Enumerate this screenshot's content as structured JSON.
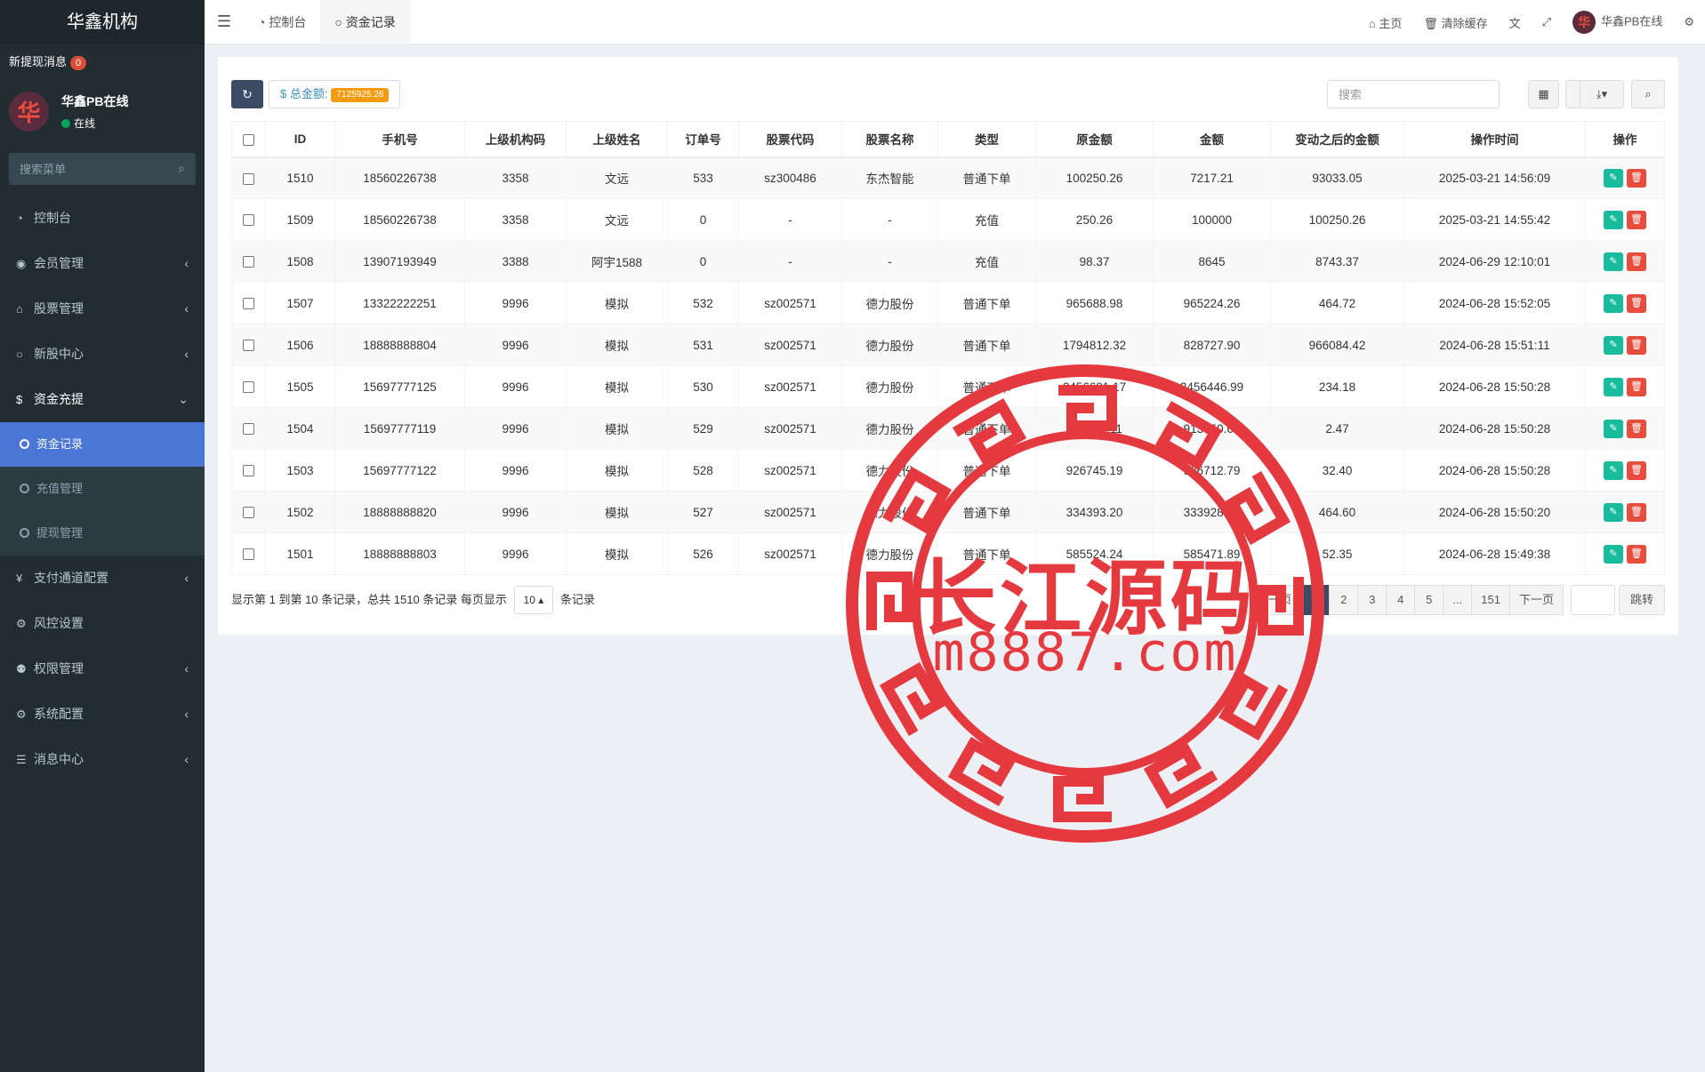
{
  "sidebar": {
    "brand": "华鑫机构",
    "notice_label": "新提现消息",
    "notice_count": "0",
    "user": {
      "avatar_glyph": "华",
      "name": "华鑫PB在线",
      "status": "在线"
    },
    "search_placeholder": "搜索菜单",
    "menu": [
      {
        "label": "控制台",
        "icon": "dashboard-icon",
        "glyph": "◔",
        "has_children": false
      },
      {
        "label": "会员管理",
        "icon": "user-circle-icon",
        "glyph": "◉",
        "has_children": true
      },
      {
        "label": "股票管理",
        "icon": "bank-icon",
        "glyph": "⌂",
        "has_children": true
      },
      {
        "label": "新股中心",
        "icon": "circle-icon",
        "glyph": "○",
        "has_children": true
      },
      {
        "label": "资金充提",
        "icon": "dollar-icon",
        "glyph": "$",
        "has_children": true,
        "open": true,
        "children": [
          {
            "label": "资金记录",
            "active": true
          },
          {
            "label": "充值管理",
            "active": false
          },
          {
            "label": "提现管理",
            "active": false
          }
        ]
      },
      {
        "label": "支付通道配置",
        "icon": "yen-icon",
        "glyph": "¥",
        "has_children": true
      },
      {
        "label": "风控设置",
        "icon": "gear-icon",
        "glyph": "⚙",
        "has_children": false
      },
      {
        "label": "权限管理",
        "icon": "group-icon",
        "glyph": "⚉",
        "has_children": true
      },
      {
        "label": "系统配置",
        "icon": "cog-icon",
        "glyph": "⚙",
        "has_children": true
      },
      {
        "label": "消息中心",
        "icon": "list-icon",
        "glyph": "☰",
        "has_children": true
      }
    ]
  },
  "header": {
    "tabs": [
      {
        "label": "控制台",
        "glyph": "◔"
      },
      {
        "label": "资金记录",
        "glyph": "○"
      }
    ],
    "home_label": "主页",
    "clear_cache_label": "清除缓存",
    "user_name": "华鑫PB在线",
    "avatar_glyph": "华"
  },
  "toolbar": {
    "total_label": "总金额:",
    "total_value": "7125925.28",
    "search_placeholder": "搜索"
  },
  "table": {
    "columns": [
      "ID",
      "手机号",
      "上级机构码",
      "上级姓名",
      "订单号",
      "股票代码",
      "股票名称",
      "类型",
      "原金额",
      "金额",
      "变动之后的金额",
      "操作时间",
      "操作"
    ],
    "rows": [
      [
        "1510",
        "18560226738",
        "3358",
        "文远",
        "533",
        "sz300486",
        "东杰智能",
        "普通下单",
        "100250.26",
        "7217.21",
        "93033.05",
        "2025-03-21 14:56:09"
      ],
      [
        "1509",
        "18560226738",
        "3358",
        "文远",
        "0",
        "-",
        "-",
        "充值",
        "250.26",
        "100000",
        "100250.26",
        "2025-03-21 14:55:42"
      ],
      [
        "1508",
        "13907193949",
        "3388",
        "阿宇1588",
        "0",
        "-",
        "-",
        "充值",
        "98.37",
        "8645",
        "8743.37",
        "2024-06-29 12:10:01"
      ],
      [
        "1507",
        "13322222251",
        "9996",
        "模拟",
        "532",
        "sz002571",
        "德力股份",
        "普通下单",
        "965688.98",
        "965224.26",
        "464.72",
        "2024-06-28 15:52:05"
      ],
      [
        "1506",
        "18888888804",
        "9996",
        "模拟",
        "531",
        "sz002571",
        "德力股份",
        "普通下单",
        "1794812.32",
        "828727.90",
        "966084.42",
        "2024-06-28 15:51:11"
      ],
      [
        "1505",
        "15697777125",
        "9996",
        "模拟",
        "530",
        "sz002571",
        "德力股份",
        "普通下单",
        "2456681.17",
        "2456446.99",
        "234.18",
        "2024-06-28 15:50:28"
      ],
      [
        "1504",
        "15697777119",
        "9996",
        "模拟",
        "529",
        "sz002571",
        "德力股份",
        "普通下单",
        "913553.11",
        "913550.64",
        "2.47",
        "2024-06-28 15:50:28"
      ],
      [
        "1503",
        "15697777122",
        "9996",
        "模拟",
        "528",
        "sz002571",
        "德力股份",
        "普通下单",
        "926745.19",
        "926712.79",
        "32.40",
        "2024-06-28 15:50:28"
      ],
      [
        "1502",
        "18888888820",
        "9996",
        "模拟",
        "527",
        "sz002571",
        "德力股份",
        "普通下单",
        "334393.20",
        "333928.60",
        "464.60",
        "2024-06-28 15:50:20"
      ],
      [
        "1501",
        "18888888803",
        "9996",
        "模拟",
        "526",
        "sz002571",
        "德力股份",
        "普通下单",
        "585524.24",
        "585471.89",
        "52.35",
        "2024-06-28 15:49:38"
      ]
    ]
  },
  "footer": {
    "info_prefix": "显示第 1 到第 10 条记录，总共 1510 条记录 每页显示",
    "page_size": "10",
    "info_suffix": "条记录",
    "pages": [
      "上一页",
      "1",
      "2",
      "3",
      "4",
      "5",
      "...",
      "151",
      "下一页"
    ],
    "active_page": "1",
    "jump_label": "跳转"
  },
  "watermark": {
    "line1": "长江源码",
    "line2": "m8887.com",
    "color": "#e53940"
  },
  "colors": {
    "sidebar_bg": "#222d32",
    "active_menu": "#4b76d6",
    "link": "#3c8dbc",
    "edit": "#18bc9c",
    "delete": "#e74c3c"
  }
}
